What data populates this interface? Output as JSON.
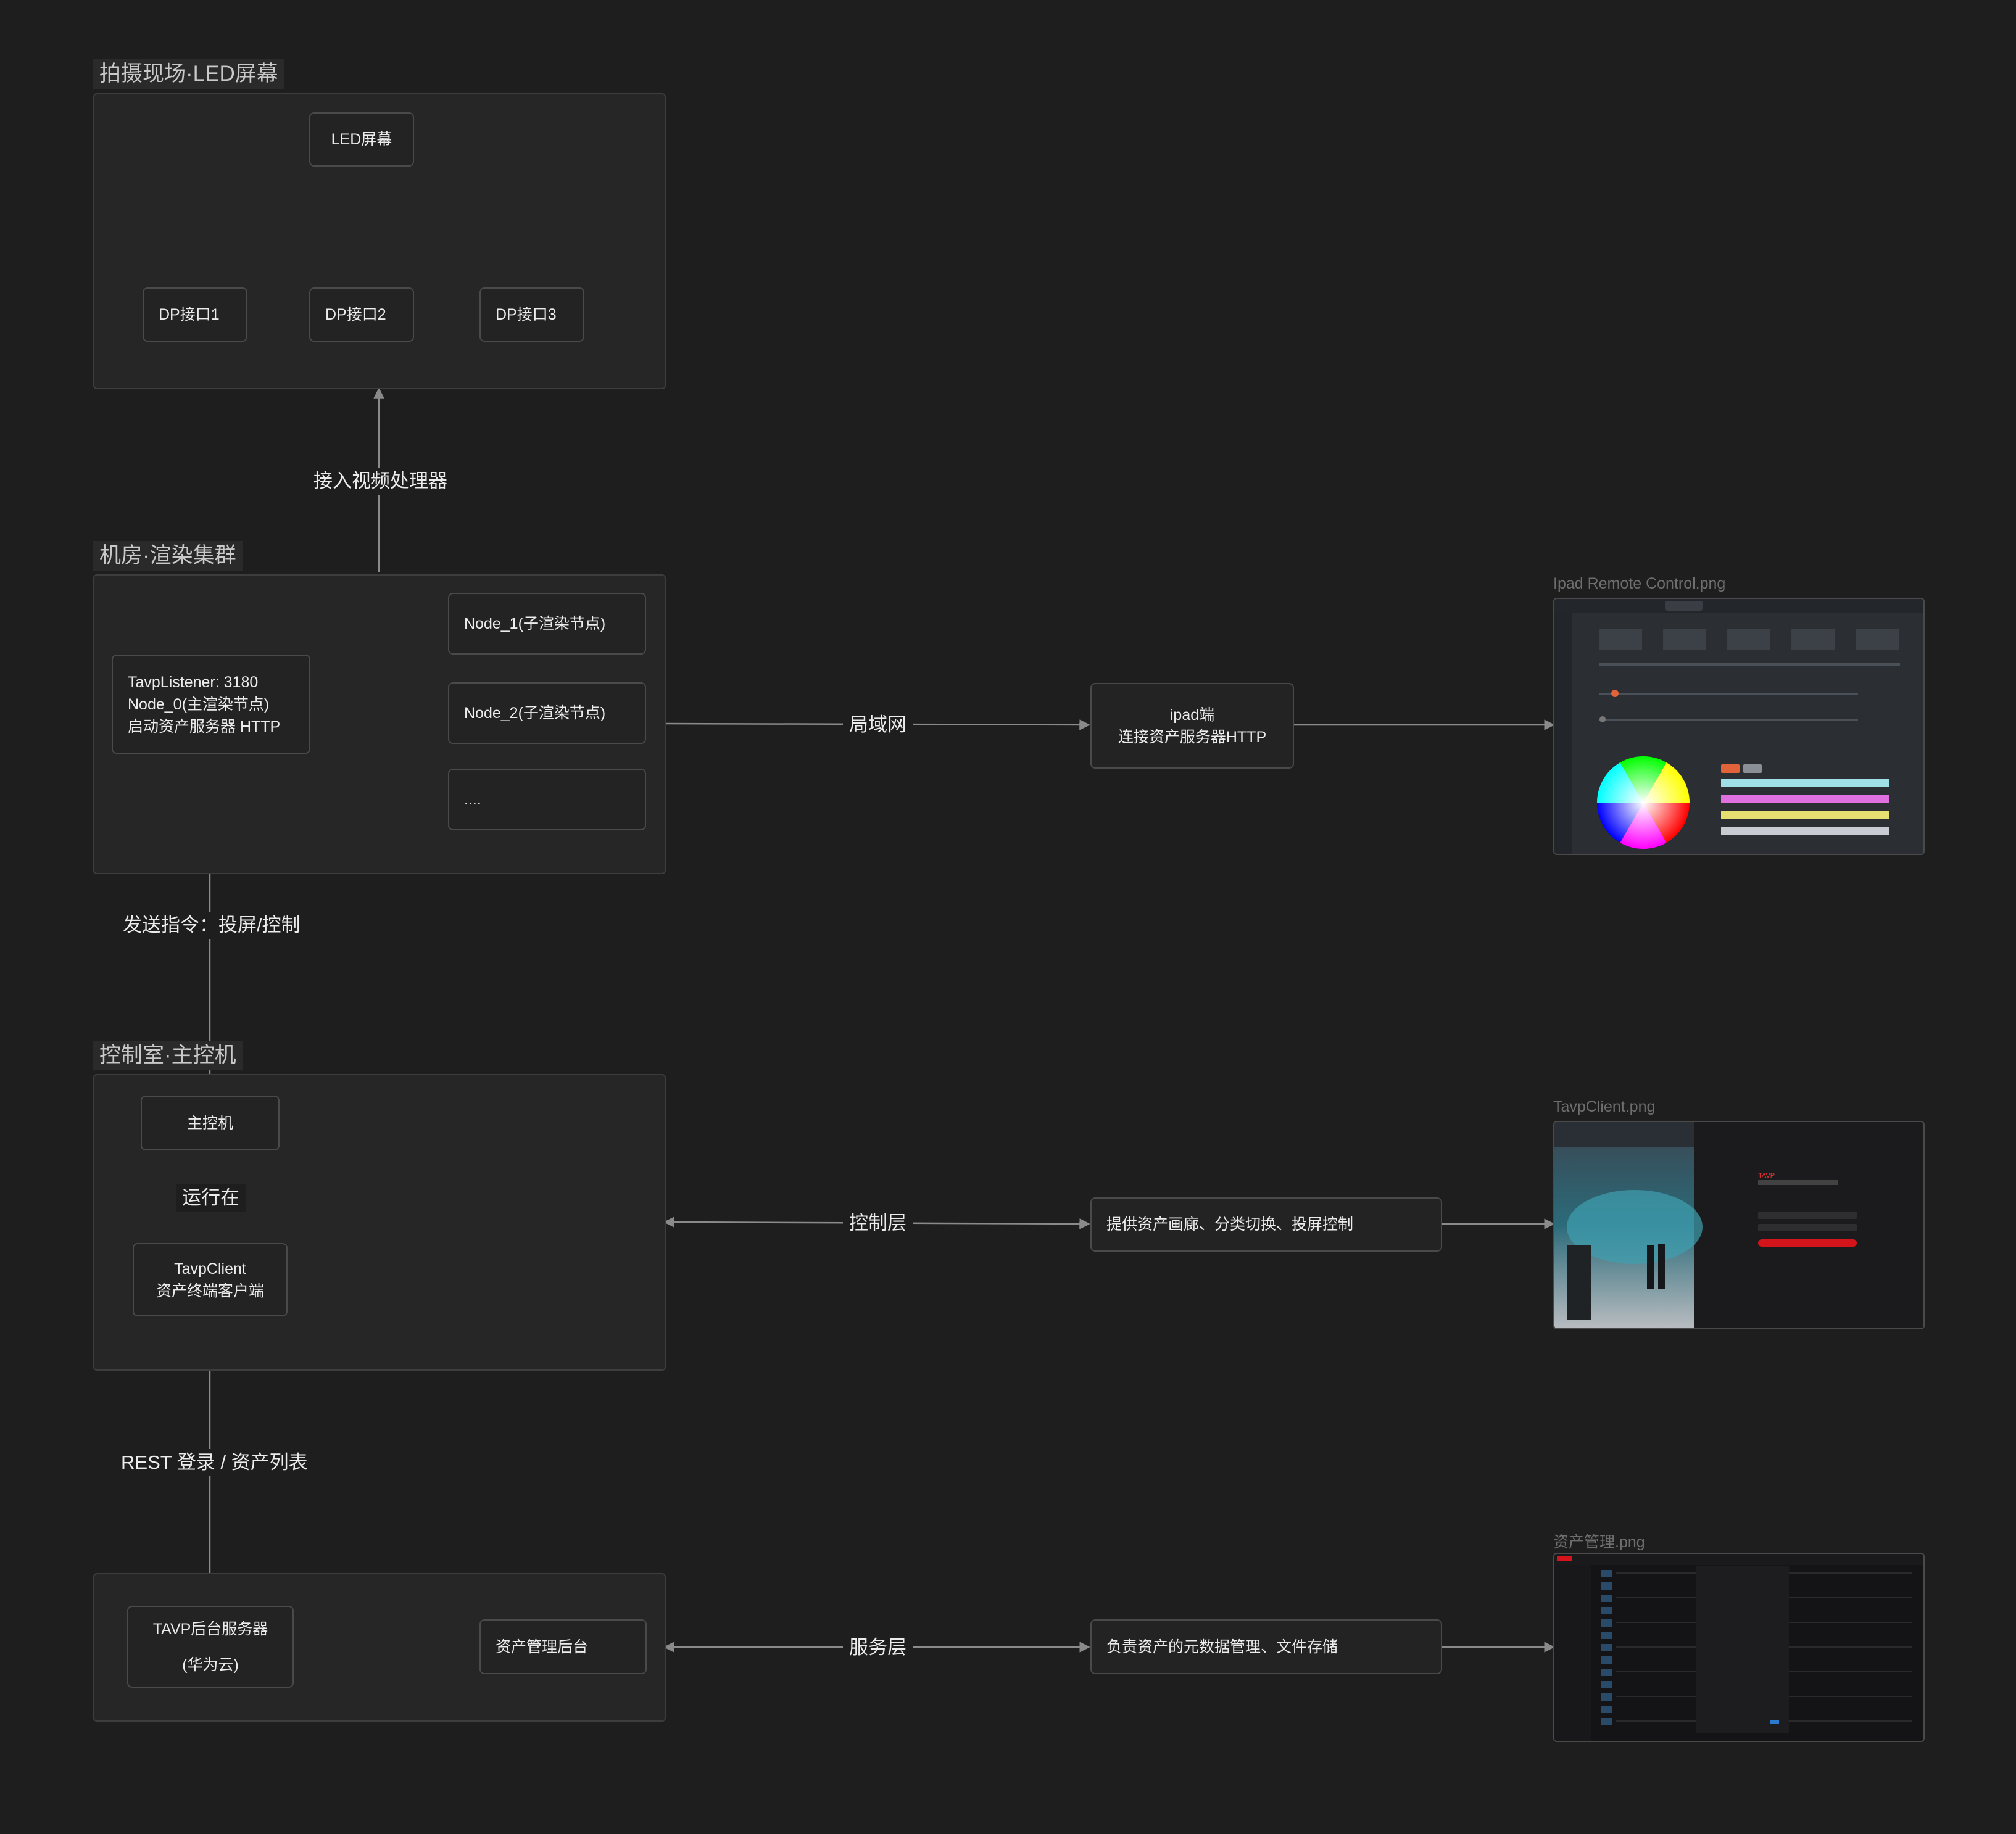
{
  "groups": {
    "led": "拍摄现场·LED屏幕",
    "render": "机房·渲染集群",
    "control": "控制室·主控机"
  },
  "nodes": {
    "led_screen": "LED屏幕",
    "dp1": "DP接口1",
    "dp2": "DP接口2",
    "dp3": "DP接口3",
    "listener": [
      "TavpListener: 3180",
      "Node_0(主渲染节点)",
      "启动资产服务器 HTTP"
    ],
    "node1": "Node_1(子渲染节点)",
    "node2": "Node_2(子渲染节点)",
    "node_more": "....",
    "ipad": [
      "ipad端",
      "连接资产服务器HTTP"
    ],
    "host": "主控机",
    "client": [
      "TavpClient",
      "资产终端客户端"
    ],
    "client_desc": "提供资产画廊、分类切换、投屏控制",
    "backend": [
      "TAVP后台服务器",
      "(华为云)"
    ],
    "asset_admin": "资产管理后台",
    "service_desc": "负责资产的元数据管理、文件存储"
  },
  "edge_labels": {
    "video_processor": "接入视频处理器",
    "lan": "局域网",
    "send_command": "发送指令：投屏/控制",
    "runs_on": "运行在",
    "control_layer": "控制层",
    "rest": "REST 登录 / 资产列表",
    "service_layer": "服务层"
  },
  "files": {
    "ipad": "Ipad Remote Control.png",
    "client": "TavpClient.png",
    "assets": "资产管理.png"
  },
  "colors": {
    "background": "#1e1e1e",
    "line": "#8a8a8a",
    "accent_red": "#d3141a"
  }
}
